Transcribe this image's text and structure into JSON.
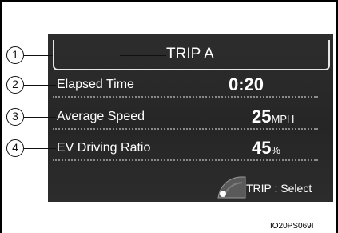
{
  "display": {
    "title": "TRIP A",
    "rows": [
      {
        "callout": "1",
        "label": "",
        "value": "",
        "unit": ""
      },
      {
        "callout": "2",
        "label": "Elapsed Time",
        "value": "0:20",
        "unit": ""
      },
      {
        "callout": "3",
        "label": "Average Speed",
        "value": "25",
        "unit": "MPH"
      },
      {
        "callout": "4",
        "label": "EV Driving Ratio",
        "value": "45",
        "unit": "%"
      }
    ],
    "switch_label": "TRIP : Select",
    "switch_icon": "steering-switch-icon"
  },
  "figure_code": "IO20PS069I",
  "colors": {
    "screen_bg": "#2b2b2b",
    "text": "#ffffff",
    "dotted": "#8a8a8a",
    "border": "#000000"
  }
}
